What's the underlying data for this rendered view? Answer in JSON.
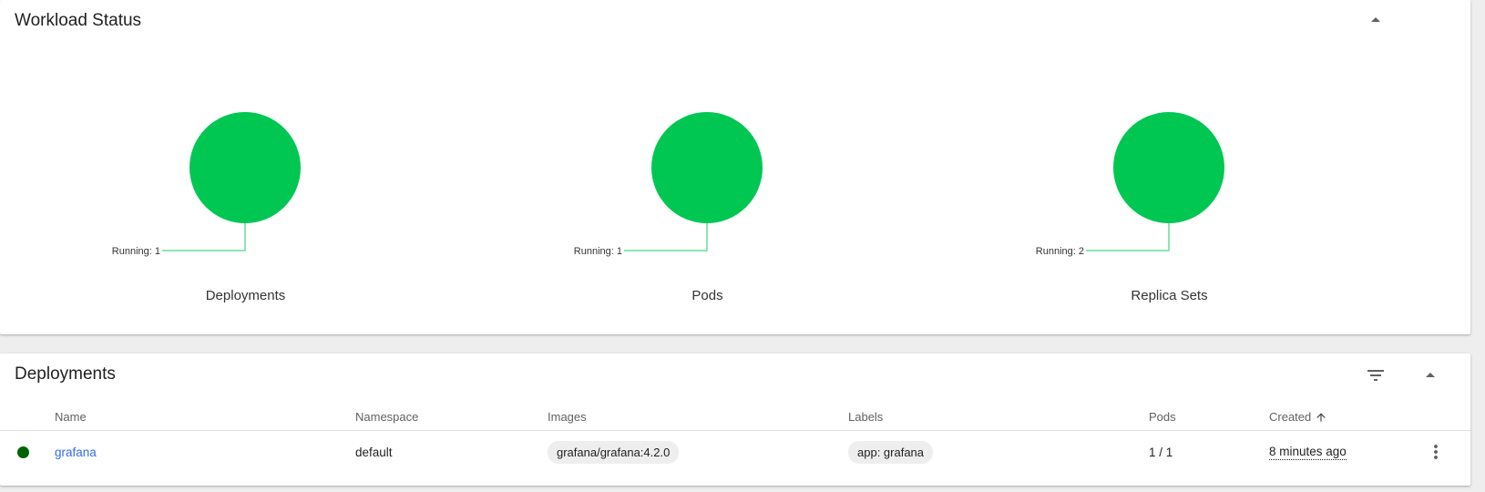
{
  "workload_status": {
    "title": "Workload Status",
    "collapse_icon": "arrow-drop-up-icon",
    "charts": [
      {
        "label": "Running: 1",
        "caption": "Deployments",
        "running": 1,
        "color": "#00c752"
      },
      {
        "label": "Running: 1",
        "caption": "Pods",
        "running": 1,
        "color": "#00c752"
      },
      {
        "label": "Running: 2",
        "caption": "Replica Sets",
        "running": 2,
        "color": "#00c752"
      }
    ]
  },
  "deployments": {
    "title": "Deployments",
    "filter_icon": "filter-list-icon",
    "collapse_icon": "arrow-drop-up-icon",
    "columns": {
      "name": "Name",
      "namespace": "Namespace",
      "images": "Images",
      "labels": "Labels",
      "pods": "Pods",
      "created": "Created"
    },
    "sort_icon": "arrow-upward-icon",
    "rows": [
      {
        "status_color": "#006400",
        "name": "grafana",
        "namespace": "default",
        "image": "grafana/grafana:4.2.0",
        "label": "app: grafana",
        "pods": "1 / 1",
        "created": "8 minutes ago",
        "menu_icon": "more-vert-icon"
      }
    ]
  },
  "colors": {
    "running_green": "#00c752",
    "connector_green": "#66dd99",
    "link_blue": "#326de6"
  }
}
